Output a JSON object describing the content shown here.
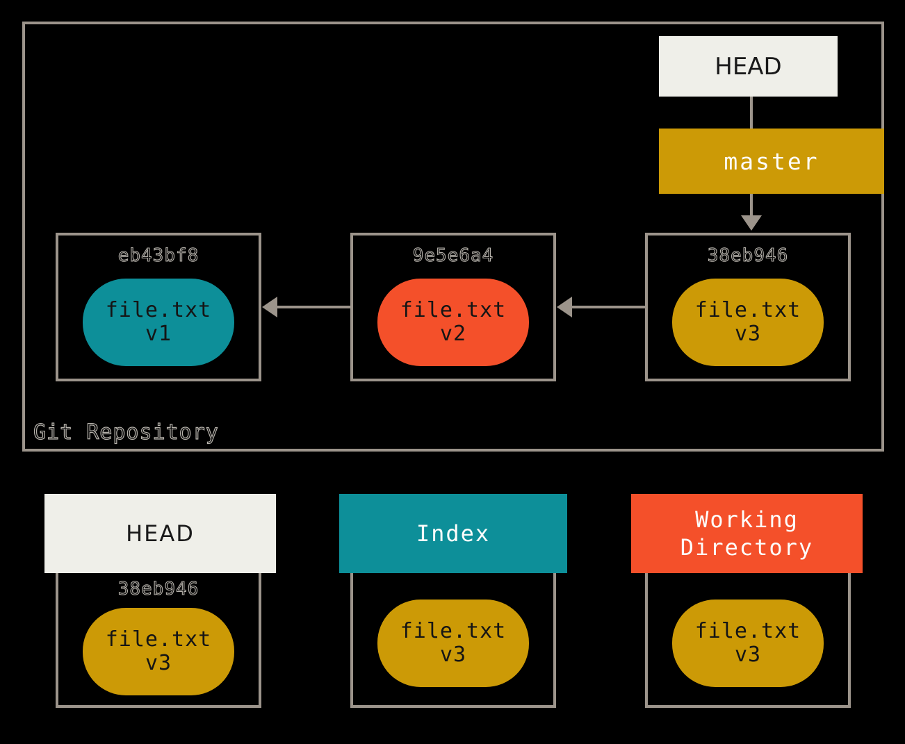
{
  "diagram": {
    "title": "Git Repository",
    "colors": {
      "background": "#000000",
      "border": "#9c948b",
      "head_box": "#efefe9",
      "branch_gold": "#cc9a06",
      "index_teal": "#0d8f99",
      "working_orange": "#f4502a",
      "hash_text": "#b6b2ab",
      "blob_text": "#151515"
    }
  },
  "repository": {
    "label": "Git Repository",
    "head_pointer": {
      "label": "HEAD",
      "icon": "pointer-box"
    },
    "branch": {
      "label": "master",
      "icon": "branch-box"
    },
    "commits": [
      {
        "hash": "eb43bf8",
        "blob_name": "file.txt",
        "blob_version": "v1",
        "blob_color": "teal"
      },
      {
        "hash": "9e5e6a4",
        "blob_name": "file.txt",
        "blob_version": "v2",
        "blob_color": "orange"
      },
      {
        "hash": "38eb946",
        "blob_name": "file.txt",
        "blob_version": "v3",
        "blob_color": "gold"
      }
    ],
    "arrows": {
      "head_to_master": "line",
      "master_to_commit": "arrow-down-icon",
      "commit2_to_commit1": "arrow-left-icon",
      "commit3_to_commit2": "arrow-left-icon"
    }
  },
  "areas": [
    {
      "header_label": "HEAD",
      "header_line2": "",
      "hash": "38eb946",
      "blob_name": "file.txt",
      "blob_version": "v3",
      "blob_color": "gold"
    },
    {
      "header_label": "Index",
      "header_line2": "",
      "hash": "",
      "blob_name": "file.txt",
      "blob_version": "v3",
      "blob_color": "gold"
    },
    {
      "header_label": "Working",
      "header_line2": "Directory",
      "hash": "",
      "blob_name": "file.txt",
      "blob_version": "v3",
      "blob_color": "gold"
    }
  ]
}
